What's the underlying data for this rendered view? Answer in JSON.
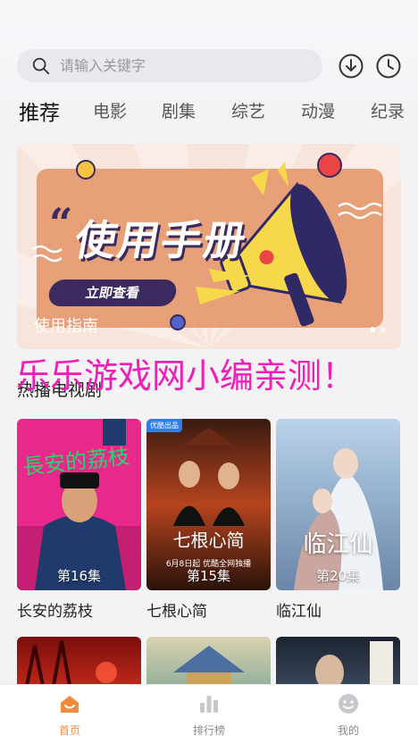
{
  "search": {
    "placeholder": "请输入关键字"
  },
  "tabs": [
    "推荐",
    "电影",
    "剧集",
    "综艺",
    "动漫",
    "纪录"
  ],
  "banner": {
    "headline": "使用手册",
    "button": "立即查看",
    "caption": "使用指南"
  },
  "watermark": "乐乐游戏网小编亲测！",
  "section": {
    "title": "热播电视剧"
  },
  "shows": [
    {
      "title": "长安的荔枝",
      "episodes": "第16集",
      "poster_text": "長安的荔枝"
    },
    {
      "title": "七根心简",
      "episodes": "第15集",
      "poster_text": "七根心简",
      "poster_date": "6月8日起 优酷全网独播",
      "badge": "优酷出品"
    },
    {
      "title": "临江仙",
      "episodes": "第20集",
      "poster_text": "临江仙"
    }
  ],
  "nav": [
    {
      "label": "首页",
      "icon": "home-icon",
      "active": true
    },
    {
      "label": "排行榜",
      "icon": "ranking-icon",
      "active": false
    },
    {
      "label": "我的",
      "icon": "profile-icon",
      "active": false
    }
  ],
  "colors": {
    "accent": "#f08a3c",
    "watermark": "#ee1fb8",
    "banner_bg": "#f6e2d8"
  }
}
